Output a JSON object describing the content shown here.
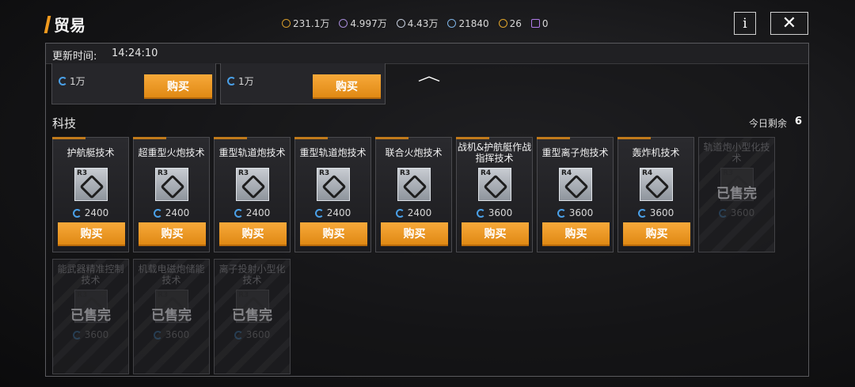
{
  "header": {
    "title": "贸易"
  },
  "currencies": [
    {
      "icon": "triangle-coin-icon",
      "value": "231.1万"
    },
    {
      "icon": "purple-coin-icon",
      "value": "4.997万"
    },
    {
      "icon": "silver-coin-icon",
      "value": "4.43万"
    },
    {
      "icon": "blue-ring-icon",
      "value": "21840"
    },
    {
      "icon": "gold-badge-icon",
      "value": "26"
    },
    {
      "icon": "purple-hex-icon",
      "value": "0"
    }
  ],
  "buttons": {
    "info": "i",
    "close": "✕",
    "collapse": "︿"
  },
  "update": {
    "label": "更新时间:",
    "time": "14:24:10"
  },
  "previous_row": [
    {
      "price": "1万",
      "buy": "购买"
    },
    {
      "price": "1万",
      "buy": "购买"
    }
  ],
  "section": {
    "title": "科技",
    "remain_label": "今日剩余",
    "remain_count": "6"
  },
  "tech_items": [
    {
      "name": "护航艇技术",
      "tier": "R3",
      "price": "2400",
      "buy": "购买",
      "sold": false
    },
    {
      "name": "超重型火炮技术",
      "tier": "R3",
      "price": "2400",
      "buy": "购买",
      "sold": false
    },
    {
      "name": "重型轨道炮技术",
      "tier": "R3",
      "price": "2400",
      "buy": "购买",
      "sold": false
    },
    {
      "name": "重型轨道炮技术",
      "tier": "R3",
      "price": "2400",
      "buy": "购买",
      "sold": false
    },
    {
      "name": "联合火炮技术",
      "tier": "R3",
      "price": "2400",
      "buy": "购买",
      "sold": false
    },
    {
      "name": "战机&护航艇作战指挥技术",
      "tier": "R4",
      "price": "3600",
      "buy": "购买",
      "sold": false
    },
    {
      "name": "重型离子炮技术",
      "tier": "R4",
      "price": "3600",
      "buy": "购买",
      "sold": false
    },
    {
      "name": "轰炸机技术",
      "tier": "R4",
      "price": "3600",
      "buy": "购买",
      "sold": false
    },
    {
      "name": "轨道炮小型化技术",
      "tier": "R3",
      "price": "3600",
      "sold_label": "已售完",
      "sold": true
    },
    {
      "name": "能武器精准控制技术",
      "tier": "R3",
      "price": "3600",
      "sold_label": "已售完",
      "sold": true
    },
    {
      "name": "机载电磁炮储能技术",
      "tier": "R3",
      "price": "3600",
      "sold_label": "已售完",
      "sold": true
    },
    {
      "name": "离子投射小型化技术",
      "tier": "R3",
      "price": "3600",
      "sold_label": "已售完",
      "sold": true
    }
  ],
  "colors": {
    "accent": "#f19a1e",
    "buy_button": "#f2a030",
    "price_ring": "#4aa0e8"
  }
}
